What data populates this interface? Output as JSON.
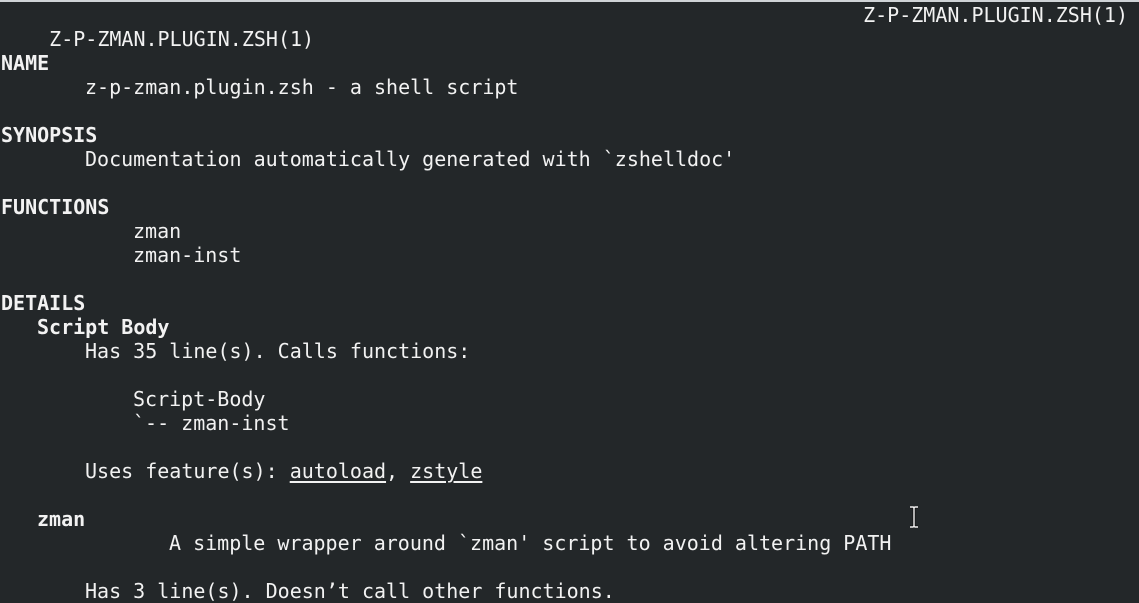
{
  "header": {
    "left": "Z-P-ZMAN.PLUGIN.ZSH(1)",
    "right": "Z-P-ZMAN.PLUGIN.ZSH(1)"
  },
  "sections": {
    "name": {
      "heading": "NAME",
      "text": "z-p-zman.plugin.zsh - a shell script"
    },
    "synopsis": {
      "heading": "SYNOPSIS",
      "text": "Documentation automatically generated with `zshelldoc'"
    },
    "functions": {
      "heading": "FUNCTIONS",
      "items": [
        "zman",
        "zman-inst"
      ]
    },
    "details": {
      "heading": "DETAILS",
      "script_body": {
        "title": "Script Body",
        "lines_text": "Has 35 line(s). Calls functions:",
        "tree_root": "Script-Body",
        "tree_child": "`-- zman-inst",
        "uses_prefix": "Uses feature(s): ",
        "features": [
          "autoload",
          "zstyle"
        ],
        "features_sep": ", "
      },
      "zman": {
        "title": "zman",
        "description": "A simple wrapper around `zman' script to avoid altering PATH",
        "lines_text": "Has 3 line(s). Doesn’t call other functions."
      }
    }
  },
  "cursor": {
    "icon": "text-cursor-ibeam-icon"
  }
}
